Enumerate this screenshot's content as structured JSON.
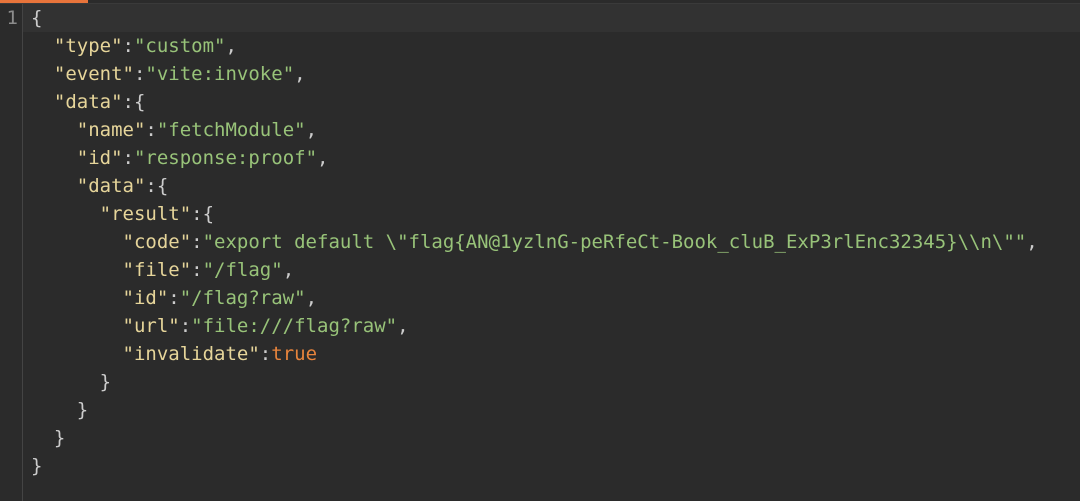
{
  "editor": {
    "gutter": {
      "line_number": "1"
    },
    "lines": [
      [
        {
          "t": "{",
          "c": "punct"
        }
      ],
      [
        {
          "t": "  ",
          "c": "punct"
        },
        {
          "t": "\"type\"",
          "c": "key"
        },
        {
          "t": ":",
          "c": "punct"
        },
        {
          "t": "\"custom\"",
          "c": "str"
        },
        {
          "t": ",",
          "c": "punct"
        }
      ],
      [
        {
          "t": "  ",
          "c": "punct"
        },
        {
          "t": "\"event\"",
          "c": "key"
        },
        {
          "t": ":",
          "c": "punct"
        },
        {
          "t": "\"vite:invoke\"",
          "c": "str"
        },
        {
          "t": ",",
          "c": "punct"
        }
      ],
      [
        {
          "t": "  ",
          "c": "punct"
        },
        {
          "t": "\"data\"",
          "c": "key"
        },
        {
          "t": ":{",
          "c": "punct"
        }
      ],
      [
        {
          "t": "    ",
          "c": "punct"
        },
        {
          "t": "\"name\"",
          "c": "key"
        },
        {
          "t": ":",
          "c": "punct"
        },
        {
          "t": "\"fetchModule\"",
          "c": "str"
        },
        {
          "t": ",",
          "c": "punct"
        }
      ],
      [
        {
          "t": "    ",
          "c": "punct"
        },
        {
          "t": "\"id\"",
          "c": "key"
        },
        {
          "t": ":",
          "c": "punct"
        },
        {
          "t": "\"response:proof\"",
          "c": "str"
        },
        {
          "t": ",",
          "c": "punct"
        }
      ],
      [
        {
          "t": "    ",
          "c": "punct"
        },
        {
          "t": "\"data\"",
          "c": "key"
        },
        {
          "t": ":{",
          "c": "punct"
        }
      ],
      [
        {
          "t": "      ",
          "c": "punct"
        },
        {
          "t": "\"result\"",
          "c": "key"
        },
        {
          "t": ":{",
          "c": "punct"
        }
      ],
      [
        {
          "t": "        ",
          "c": "punct"
        },
        {
          "t": "\"code\"",
          "c": "key"
        },
        {
          "t": ":",
          "c": "punct"
        },
        {
          "t": "\"export default \\\"flag{AN@1yzlnG-peRfeCt-Book_cluB_ExP3rlEnc32345}\\\\n\\\"\"",
          "c": "str"
        },
        {
          "t": ",",
          "c": "punct"
        }
      ],
      [
        {
          "t": "        ",
          "c": "punct"
        },
        {
          "t": "\"file\"",
          "c": "key"
        },
        {
          "t": ":",
          "c": "punct"
        },
        {
          "t": "\"/flag\"",
          "c": "str"
        },
        {
          "t": ",",
          "c": "punct"
        }
      ],
      [
        {
          "t": "        ",
          "c": "punct"
        },
        {
          "t": "\"id\"",
          "c": "key"
        },
        {
          "t": ":",
          "c": "punct"
        },
        {
          "t": "\"/flag?raw\"",
          "c": "str"
        },
        {
          "t": ",",
          "c": "punct"
        }
      ],
      [
        {
          "t": "        ",
          "c": "punct"
        },
        {
          "t": "\"url\"",
          "c": "key"
        },
        {
          "t": ":",
          "c": "punct"
        },
        {
          "t": "\"file:///flag?raw\"",
          "c": "str"
        },
        {
          "t": ",",
          "c": "punct"
        }
      ],
      [
        {
          "t": "        ",
          "c": "punct"
        },
        {
          "t": "\"invalidate\"",
          "c": "key"
        },
        {
          "t": ":",
          "c": "punct"
        },
        {
          "t": "true",
          "c": "bool"
        }
      ],
      [
        {
          "t": "      }",
          "c": "punct"
        }
      ],
      [
        {
          "t": "    }",
          "c": "punct"
        }
      ],
      [
        {
          "t": "  }",
          "c": "punct"
        }
      ],
      [
        {
          "t": "}",
          "c": "punct"
        }
      ]
    ]
  },
  "colors": {
    "background": "#2b2b2b",
    "key": "#e6d59a",
    "string": "#98c379",
    "boolean": "#e8843c",
    "tab_accent": "#e8743b"
  }
}
